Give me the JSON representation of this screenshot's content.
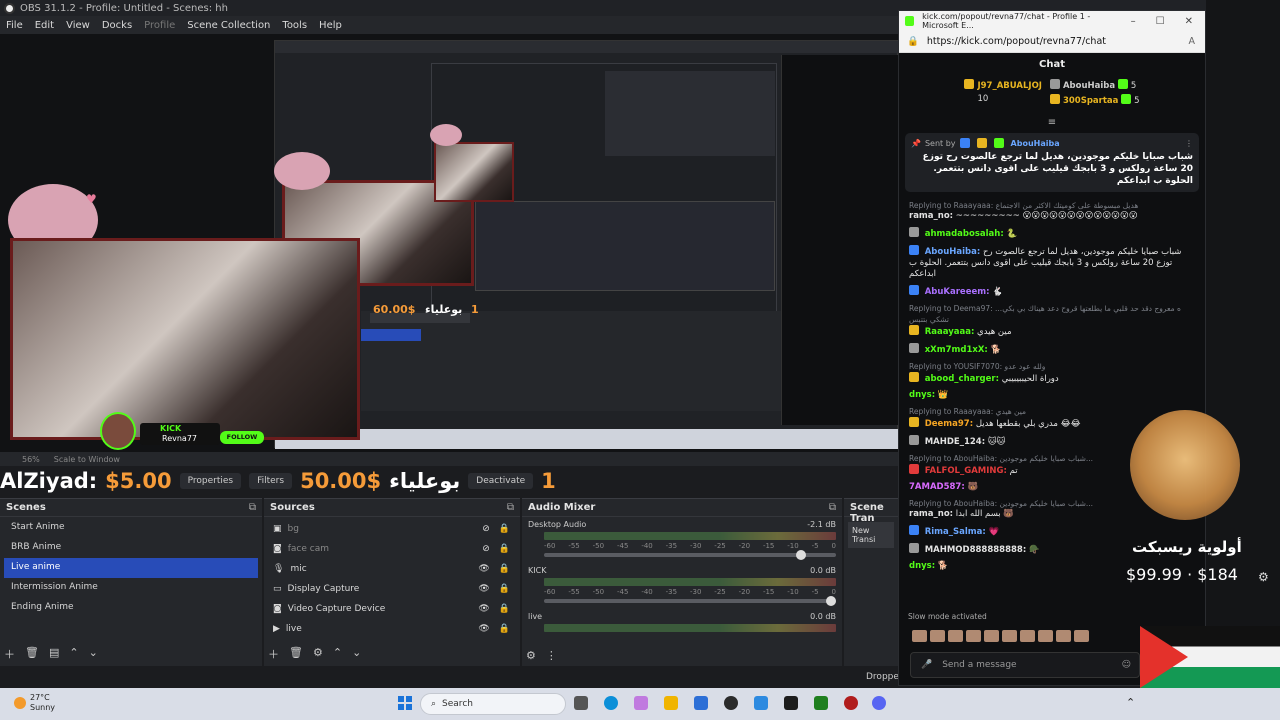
{
  "obs": {
    "title": "OBS 31.1.2 - Profile: Untitled - Scenes: hh",
    "menu": [
      "File",
      "Edit",
      "View",
      "Docks",
      "Profile",
      "Scene Collection",
      "Tools",
      "Help"
    ],
    "status_zoom": "56%",
    "status_scale": "Scale to Window"
  },
  "preview": {
    "kick_label": "KICK",
    "kick_user": "Revna77",
    "kick_follow": "FOLLOW",
    "nested_amount": "60.00$",
    "nested_count": "1",
    "nested_name": "بوعلياء"
  },
  "ticker": {
    "name1": "AlZiyad:",
    "amt1": "$5.00",
    "amt2": "50.00$",
    "name2": "بوعلياء",
    "count": "1",
    "btn_properties": "Properties",
    "btn_filters": "Filters",
    "btn_deactivate": "Deactivate"
  },
  "scenes": {
    "title": "Scenes",
    "items": [
      "Start Anime",
      "BRB Anime",
      "Live anime",
      "Intermission Anime",
      "Ending Anime"
    ],
    "selected_index": 2
  },
  "sources": {
    "title": "Sources",
    "items": [
      {
        "label": "bg",
        "icon": "image-icon",
        "visible": false
      },
      {
        "label": "face cam",
        "icon": "camera-icon",
        "visible": false
      },
      {
        "label": "mic",
        "icon": "mic-icon",
        "visible": true
      },
      {
        "label": "Display Capture",
        "icon": "display-icon",
        "visible": true
      },
      {
        "label": "Video Capture Device",
        "icon": "camera-icon",
        "visible": true
      },
      {
        "label": "live",
        "icon": "play-icon",
        "visible": true
      }
    ]
  },
  "mixer": {
    "title": "Audio Mixer",
    "channels": [
      {
        "name": "Desktop Audio",
        "db": "-2.1 dB",
        "level": 0.9
      },
      {
        "name": "KICK",
        "db": "0.0 dB",
        "level": 1.0
      },
      {
        "name": "live",
        "db": "0.0 dB",
        "level": 1.0
      }
    ],
    "scale": [
      "-60",
      "-55",
      "-50",
      "-45",
      "-40",
      "-35",
      "-30",
      "-25",
      "-20",
      "-15",
      "-10",
      "-5",
      "0"
    ]
  },
  "transitions": {
    "title": "Scene Transitions",
    "title_visible": "Scene Tran",
    "item": "New Transi"
  },
  "edge": {
    "title": "kick.com/popout/revna77/chat - Profile 1 - Microsoft E...",
    "url": "https://kick.com/popout/revna77/chat",
    "controls": [
      "–",
      "☐",
      "✕"
    ]
  },
  "chat": {
    "header": "Chat",
    "leaderboard": [
      {
        "name": "J97_ABUALJOJ",
        "count": "10",
        "color": "#e8b521"
      },
      {
        "name": "AbouHaiba",
        "count": "5",
        "color": "#cccccc"
      },
      {
        "name": "300Spartaa",
        "count": "5",
        "color": "#e8b521"
      }
    ],
    "pinned": {
      "by_label": "Sent by",
      "user": "AbouHaiba",
      "message": "شباب صبايا خليكم موجودين، هديل لما ترجع عالصوت رح توزع 20 ساعة رولكس و 3 بابجك قيليب على اقوى دانس بتتعمر. الحلوة ب ابداعكم"
    },
    "messages": [
      {
        "reply": "Replying to Raaayaaa: هديل مبسوطة على كوميتك الاكثر من الاجتماع",
        "user": "rama_no:",
        "color": "#e2e2e2",
        "text": "~~~~~~~~~ 😮😮😮😮😮😮😮😮😮😮😮😮😮"
      },
      {
        "reply": "",
        "user": "ahmadabosalah:",
        "color": "#53fc18",
        "text": "🐍"
      },
      {
        "reply": "",
        "user": "AbouHaiba:",
        "color": "#6aa6ff",
        "text": "شباب صبايا خليكم موجودين، هديل لما ترجع عالصوت رح توزع 20 ساعة رولكس و 3 بابجك قيليب على اقوى دانس بتتعمر. الحلوة ب ابداعكم"
      },
      {
        "reply": "",
        "user": "AbuKareeem:",
        "color": "#a970ff",
        "text": "🐇"
      },
      {
        "reply": "Replying to Deema97: ...ه معروج دقد حد قلبي ما يطلعتها قروح دعد هيناك بي بكي تشكي بتتبس",
        "user": "Raaayaaa:",
        "color": "#53fc18",
        "text": "مين هيدي"
      },
      {
        "reply": "",
        "user": "xXm7md1xX:",
        "color": "#53fc18",
        "text": "🐕"
      },
      {
        "reply": "Replying to YOUSIF7070: ولله عود عدو",
        "user": "abood_charger:",
        "color": "#53fc18",
        "text": "دوراة الحيببيبيبي"
      },
      {
        "reply": "",
        "user": "dnys:",
        "color": "#53fc18",
        "text": "👑"
      },
      {
        "reply": "Replying to Raaayaaa: مين هيدي",
        "user": "Deema97:",
        "color": "#f5a524",
        "text": "مدري بلي بقطعها هديل 😂😂"
      },
      {
        "reply": "",
        "user": "MAHDE_124:",
        "color": "#e2e2e2",
        "text": "🐱🐱"
      },
      {
        "reply": "Replying to AbouHaiba: شباب صبايا خليكم موجودين...",
        "user": "FALFOL_GAMING:",
        "color": "#e23b3b",
        "text": "تم"
      },
      {
        "reply": "",
        "user": "7AMAD587:",
        "color": "#d96bff",
        "text": "🐻"
      },
      {
        "reply": "Replying to AbouHaiba: شباب صبايا خليكم موجودين...",
        "user": "rama_no:",
        "color": "#e2e2e2",
        "text": "بسم الله ابدا 🐻"
      },
      {
        "reply": "",
        "user": "Rima_Salma:",
        "color": "#6aa6ff",
        "text": "💗"
      },
      {
        "reply": "",
        "user": "MAHMOD888888888:",
        "color": "#e2e2e2",
        "text": "🪖"
      },
      {
        "reply": "",
        "user": "dnys:",
        "color": "#53fc18",
        "text": "🐕"
      }
    ],
    "slow_mode": "Slow mode activated",
    "input_placeholder": "Send a message",
    "dropdown_stub": "Droppe"
  },
  "overlay": {
    "priority_title": "أولوية ريسبكت",
    "priority_amount": "$99.99 · $184"
  },
  "taskbar": {
    "weather_temp": "27°C",
    "weather_desc": "Sunny",
    "search_placeholder": "Search"
  },
  "colors": {
    "accent_selected": "#284cb8",
    "kick_green": "#53fc18",
    "ticker_amount": "#f59b39",
    "panel_bg": "#25272b"
  }
}
